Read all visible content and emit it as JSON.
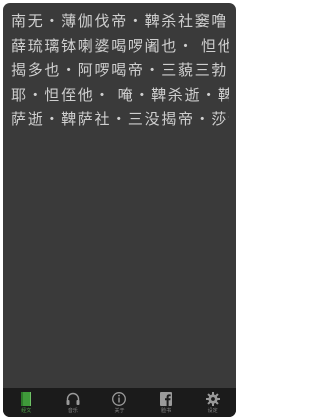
{
  "mantra": {
    "lines": [
      "南无・薄伽伐帝・鞞杀社窭噜・",
      "薛琉璃钵喇婆喝啰阇也・ 怛他",
      "揭多也・阿啰喝帝・三藐三勃陀",
      "耶・怛侄他・ 唵・鞞杀逝・鞞",
      "萨逝・鞞萨社・三没揭帝・莎诃"
    ]
  },
  "tabbar": {
    "tabs": [
      {
        "label": "经文",
        "icon": "book-icon",
        "active": true
      },
      {
        "label": "音乐",
        "icon": "headphones-icon",
        "active": false
      },
      {
        "label": "关于",
        "icon": "info-icon",
        "active": false
      },
      {
        "label": "脸书",
        "icon": "facebook-icon",
        "active": false
      },
      {
        "label": "设定",
        "icon": "gear-icon",
        "active": false
      }
    ],
    "active_color": "#4fa548",
    "background": "#1b1b1b"
  }
}
